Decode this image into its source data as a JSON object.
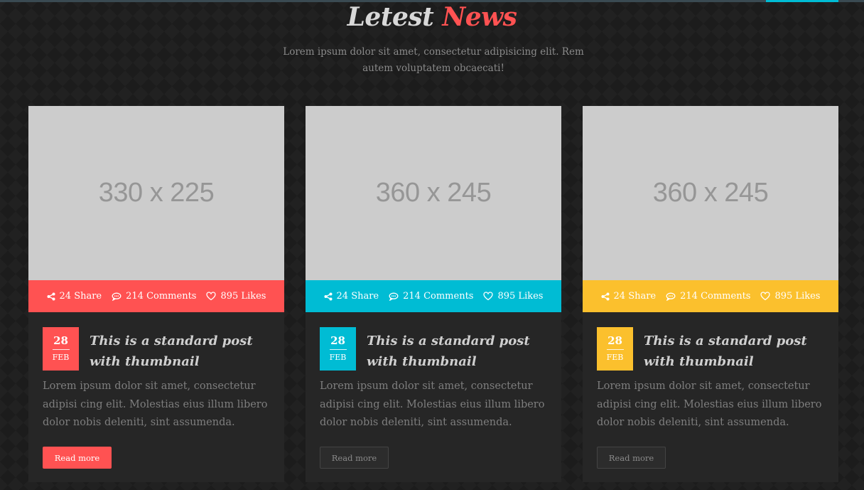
{
  "section": {
    "title_part1": "Letest",
    "title_part2": "News",
    "subtitle": "Lorem ipsum dolor sit amet, consectetur adipisicing elit. Rem autem voluptatem obcaecati!"
  },
  "colors": {
    "red": "#ff5252",
    "cyan": "#00bcd4",
    "yellow": "#fbc02d",
    "card_bg": "#262626",
    "thumb_bg": "#cccccc"
  },
  "posts": [
    {
      "thumbnail_label": "330 x 225",
      "accent": "#ff5252",
      "shares": "24 Share",
      "comments": "214 Comments",
      "likes": "895 Likes",
      "day": "28",
      "month": "FEB",
      "title": "This is a standard post with thumbnail",
      "excerpt": "Lorem ipsum dolor sit amet, consectetur adipisi cing elit. Molestias eius illum libero dolor nobis deleniti, sint assumenda.",
      "button": "Read more",
      "button_style": "primary"
    },
    {
      "thumbnail_label": "360 x 245",
      "accent": "#00bcd4",
      "shares": "24 Share",
      "comments": "214 Comments",
      "likes": "895 Likes",
      "day": "28",
      "month": "FEB",
      "title": "This is a standard post with thumbnail",
      "excerpt": "Lorem ipsum dolor sit amet, consectetur adipisi cing elit. Molestias eius illum libero dolor nobis deleniti, sint assumenda.",
      "button": "Read more",
      "button_style": "ghost"
    },
    {
      "thumbnail_label": "360 x 245",
      "accent": "#fbc02d",
      "shares": "24 Share",
      "comments": "214 Comments",
      "likes": "895 Likes",
      "day": "28",
      "month": "FEB",
      "title": "This is a standard post with thumbnail",
      "excerpt": "Lorem ipsum dolor sit amet, consectetur adipisi cing elit. Molestias eius illum libero dolor nobis deleniti, sint assumenda.",
      "button": "Read more",
      "button_style": "ghost"
    }
  ],
  "icons": {
    "share": "share-icon",
    "comment": "comment-icon",
    "like": "heart-icon"
  }
}
